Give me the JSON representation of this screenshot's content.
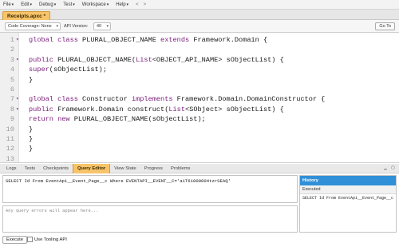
{
  "menubar": {
    "items": [
      "File",
      "Edit",
      "Debug",
      "Test",
      "Workspace",
      "Help"
    ],
    "back_arrow": "<",
    "forward_arrow": ">"
  },
  "tab": {
    "file_name": "Receipts.apxc *"
  },
  "toolbar": {
    "code_coverage": "Code Coverage: None",
    "api_version_label": "API Version:",
    "api_version": "40",
    "goto_label": "Go To"
  },
  "editor": {
    "lines": [
      {
        "no": "1",
        "fold": "▾",
        "tokens": [
          [
            "kw",
            "global class"
          ],
          [
            "",
            " PLURAL_OBJECT_NAME "
          ],
          [
            "kw",
            "extends"
          ],
          [
            "",
            " Framework.Domain {"
          ]
        ]
      },
      {
        "no": "2",
        "fold": "",
        "tokens": []
      },
      {
        "no": "3",
        "fold": "▾",
        "tokens": [
          [
            "kw",
            "public"
          ],
          [
            "",
            " PLURAL_OBJECT_NAME("
          ],
          [
            "kw",
            "List"
          ],
          [
            "",
            "<OBJECT_API_NAME> sObjectList) {"
          ]
        ]
      },
      {
        "no": "4",
        "fold": "",
        "tokens": [
          [
            "kw",
            "super"
          ],
          [
            "",
            "(sObjectList);"
          ]
        ]
      },
      {
        "no": "5",
        "fold": "",
        "tokens": [
          [
            "",
            "}"
          ]
        ]
      },
      {
        "no": "6",
        "fold": "",
        "tokens": []
      },
      {
        "no": "7",
        "fold": "▾",
        "tokens": [
          [
            "kw",
            "global class"
          ],
          [
            "",
            " Constructor "
          ],
          [
            "kw",
            "implements"
          ],
          [
            "",
            " Framework.Domain.DomainConstructor {"
          ]
        ]
      },
      {
        "no": "8",
        "fold": "▾",
        "tokens": [
          [
            "kw",
            "public"
          ],
          [
            "",
            " Framework.Domain construct("
          ],
          [
            "kw",
            "List"
          ],
          [
            "",
            "<SObject> sObjectList) {"
          ]
        ]
      },
      {
        "no": "9",
        "fold": "",
        "tokens": [
          [
            "kw",
            "return new"
          ],
          [
            "",
            " PLURAL_OBJECT_NAME(sObjectList);"
          ]
        ]
      },
      {
        "no": "10",
        "fold": "",
        "tokens": [
          [
            "",
            "}"
          ]
        ]
      },
      {
        "no": "11",
        "fold": "",
        "tokens": [
          [
            "",
            "}"
          ]
        ]
      },
      {
        "no": "12",
        "fold": "",
        "tokens": [
          [
            "",
            "}"
          ]
        ]
      },
      {
        "no": "13",
        "fold": "",
        "tokens": []
      }
    ]
  },
  "bottom_tabs": [
    "Logs",
    "Tests",
    "Checkpoints",
    "Query Editor",
    "View State",
    "Progress",
    "Problems"
  ],
  "active_bottom_tab": "Query Editor",
  "query": {
    "text": "SELECT Id From EventApi__Event_Page__c Where EVENTAPI__EVENT__C='a1T61000004tzrSEAQ'",
    "errors_placeholder": "Any query errors will appear here..."
  },
  "history": {
    "title": "History",
    "column": "Executed",
    "rows": [
      "SELECT Id From EventApi__Event_Page__c Whe"
    ]
  },
  "footer": {
    "execute_label": "Execute",
    "tooling_label": "Use Tooling API"
  },
  "colors": {
    "active_tab": "#f8c46a",
    "history_header": "#2f8fd8",
    "keyword": "#7a1c7a"
  }
}
